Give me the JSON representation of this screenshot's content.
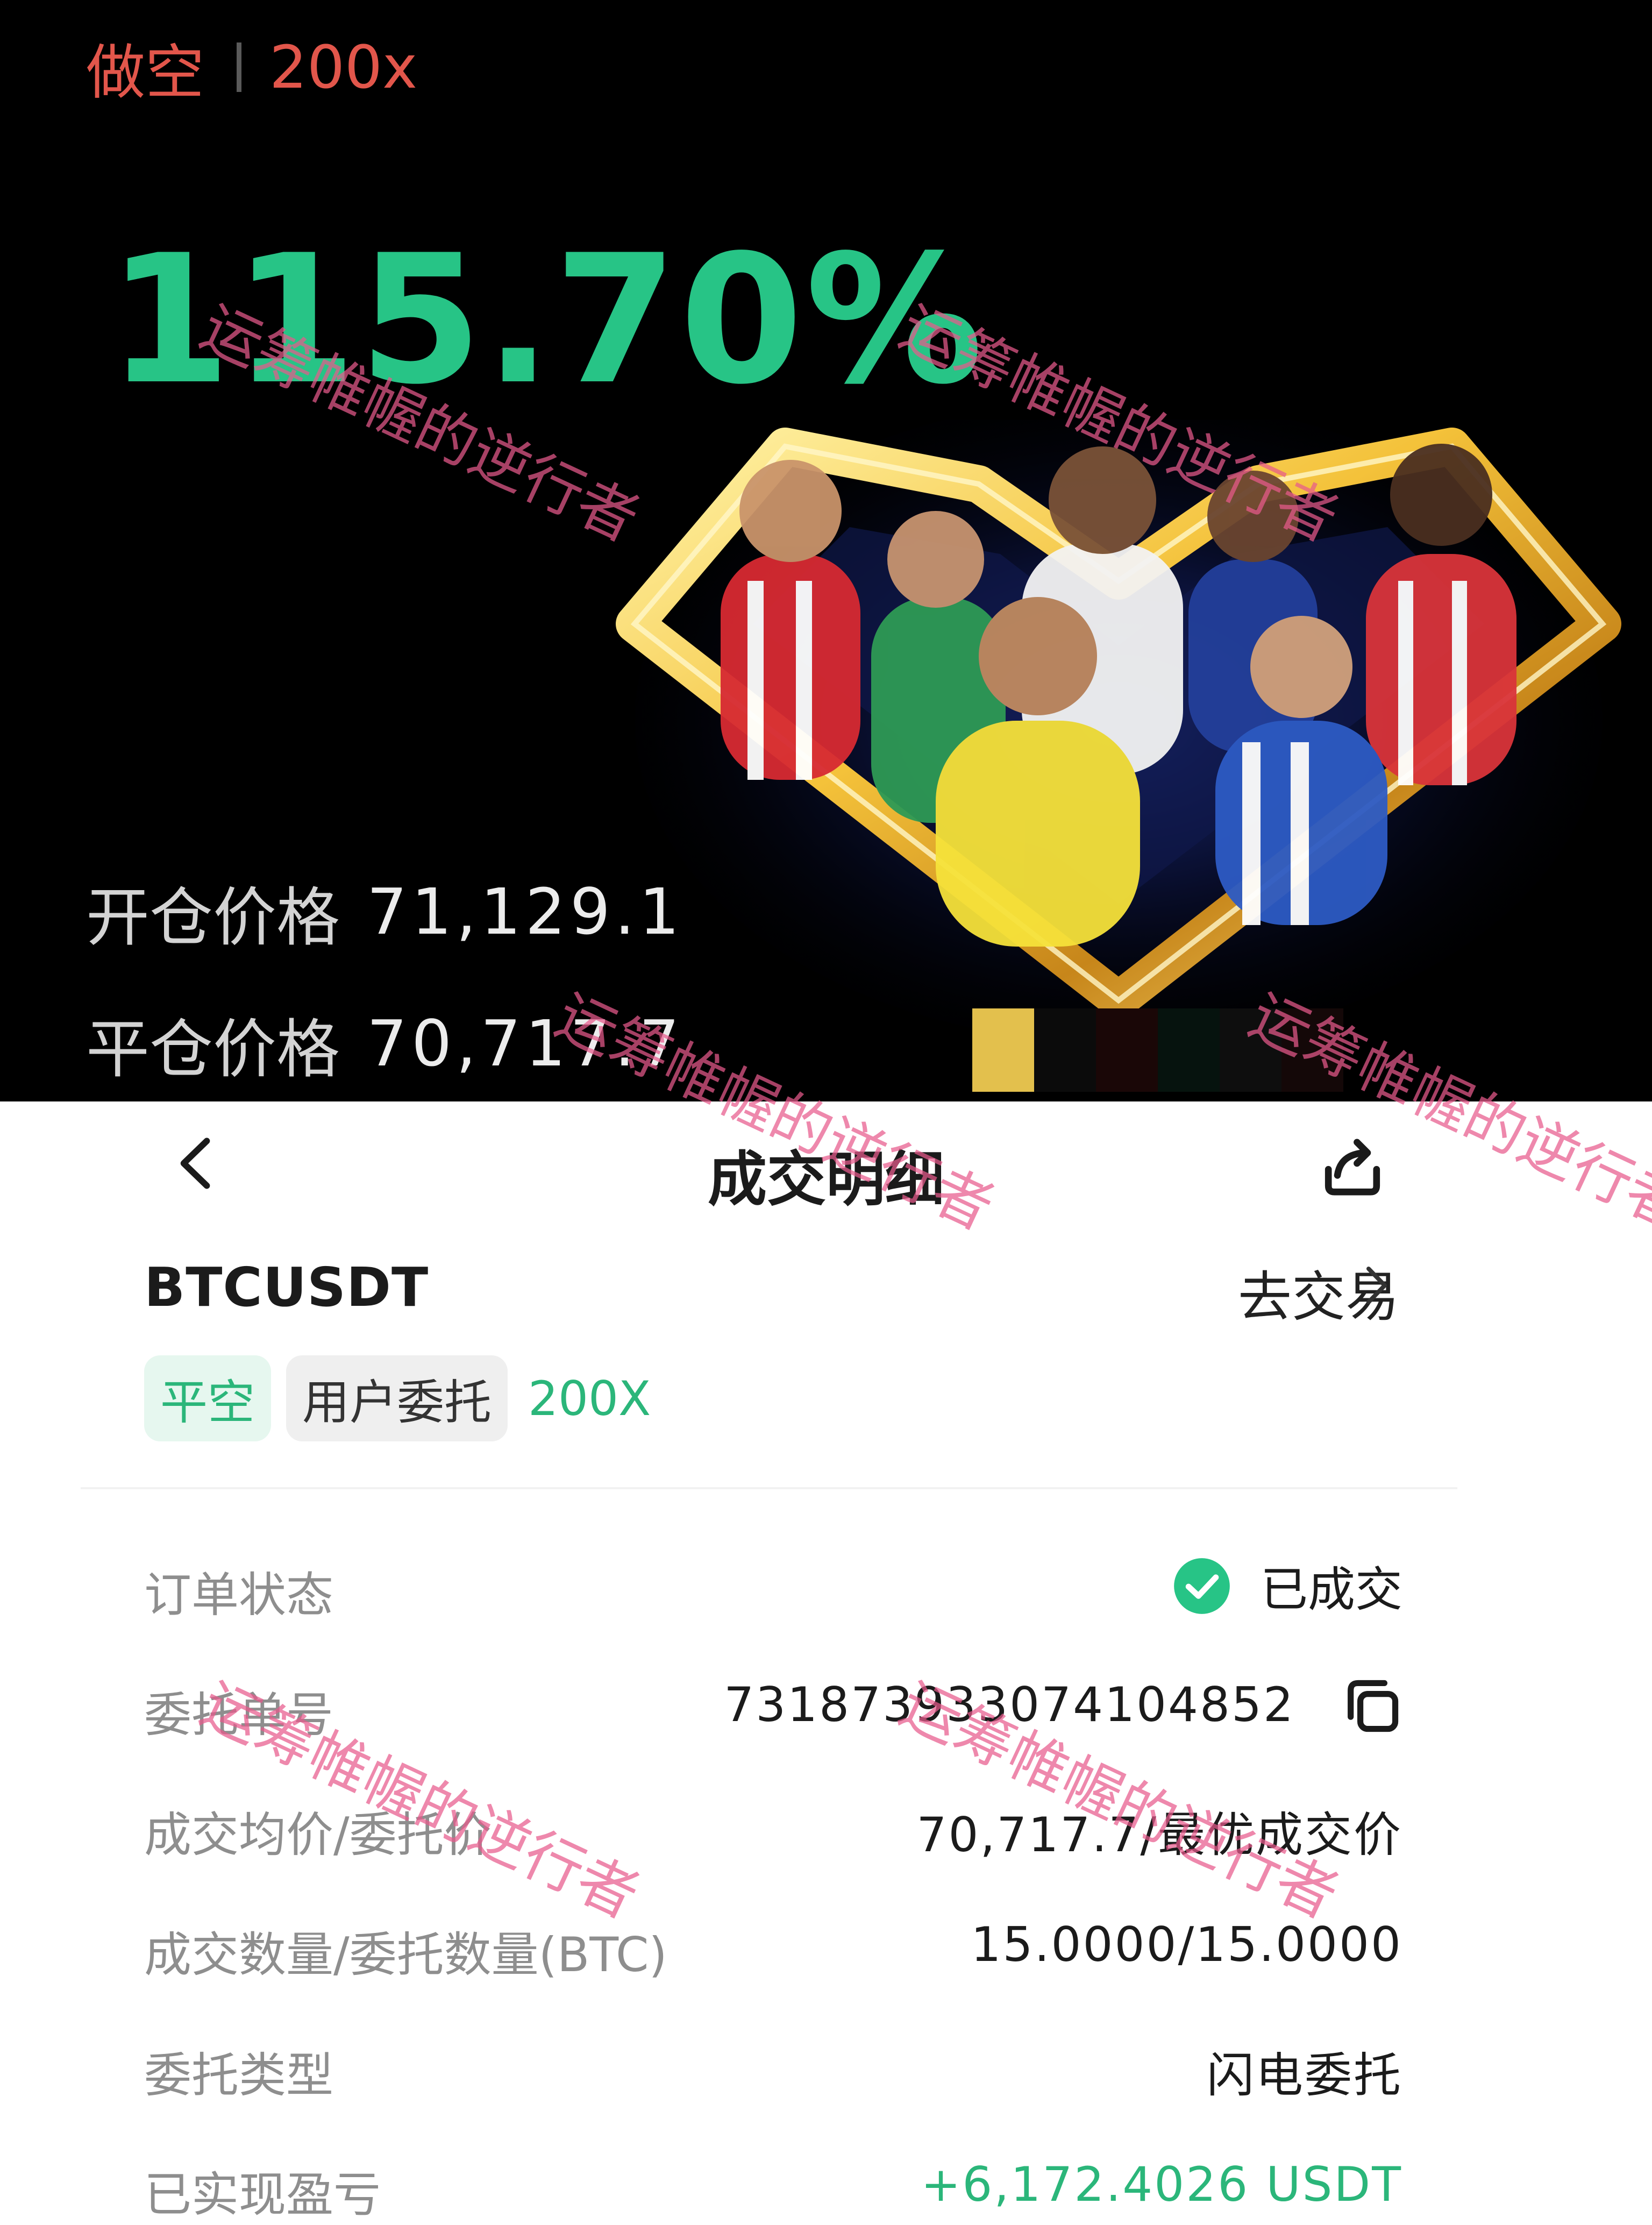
{
  "card": {
    "side": "做空",
    "leverage": "200x",
    "roe": "115.70%",
    "open_price_label": "开仓价格",
    "open_price": "71,129.1",
    "close_price_label": "平仓价格",
    "close_price": "70,717.7"
  },
  "nav": {
    "title": "成交明细"
  },
  "order": {
    "symbol": "BTCUSDT",
    "go_trade": "去交易",
    "tags": [
      "平空",
      "用户委托"
    ],
    "leverage": "200X"
  },
  "details": {
    "status_label": "订单状态",
    "status_value": "已成交",
    "order_id_label": "委托单号",
    "order_id": "731873933074104852",
    "avg_price_label": "成交均价/委托价",
    "avg_price": "70,717.7/最优成交价",
    "qty_label": "成交数量/委托数量(BTC)",
    "qty": "15.0000/15.0000",
    "type_label": "委托类型",
    "type": "闪电委托",
    "pnl_label": "已实现盈亏",
    "pnl": "+6,172.4026 USDT"
  },
  "watermark": "运筹帷幄的逆行者",
  "colors": {
    "profit_green": "#27c486",
    "short_red": "#e2564b",
    "tag_green": "#2bb67a",
    "watermark_pink": "#e85a8c"
  }
}
